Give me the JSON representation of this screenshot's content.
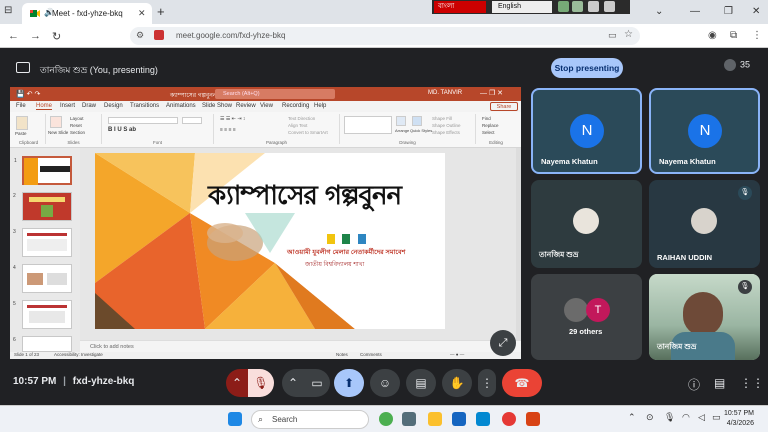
{
  "browser": {
    "tab_title": "Meet - fxd-yhze-bkq",
    "url": "meet.google.com/fxd-yhze-bkq",
    "bangla_bar": {
      "left_text": "বাংলা",
      "english_label": "English"
    }
  },
  "meet": {
    "presenting_text": "তানজিম শুভ্র (You, presenting)",
    "stop_presenting_label": "Stop presenting",
    "participant_count": "35",
    "time": "10:57 PM",
    "meeting_code": "fxd-yhze-bkq",
    "participants": [
      {
        "name": "Nayema Khatun",
        "initial": "N"
      },
      {
        "name": "Nayema Khatun",
        "initial": "N"
      },
      {
        "name": "তানজিম শুভ্র"
      },
      {
        "name": "RAIHAN UDDIN"
      },
      {
        "name": "29 others",
        "initial": "T"
      },
      {
        "name": "তানজিম শুভ্র"
      }
    ]
  },
  "powerpoint": {
    "file_name": "ক্যাম্পাসের গল্পবুনন_Mi.pptx - PowerPoint",
    "search_placeholder": "Search (Alt+Q)",
    "user": "MD. TANVIR",
    "share_label": "Share",
    "tabs": [
      "File",
      "Home",
      "Insert",
      "Draw",
      "Design",
      "Transitions",
      "Animations",
      "Slide Show",
      "Review",
      "View",
      "Recording",
      "Help"
    ],
    "ribbon_groups": [
      "Clipboard",
      "Slides",
      "Font",
      "Paragraph",
      "Drawing",
      "Editing"
    ],
    "ribbon_labels": {
      "paste": "Paste",
      "new_slide": "New Slide",
      "layout": "Layout",
      "reset": "Reset",
      "section": "Section",
      "arrange": "Arrange",
      "quick_styles": "Quick Styles",
      "shape_fill": "Shape Fill",
      "shape_outline": "Shape Outline",
      "shape_effects": "Shape Effects",
      "find": "Find",
      "replace": "Replace",
      "select": "Select",
      "text_direction": "Text Direction",
      "align_text": "Align Text",
      "convert_smartart": "Convert to SmartArt"
    },
    "slide_numbers": [
      "1",
      "2",
      "3",
      "4",
      "5",
      "6"
    ],
    "slide": {
      "title": "ক্যাম্পাসের গল্পবুনন",
      "subtitle": "আওয়ামী যুবলীগ মেলার নেতাকর্মীদের সমাবেশ",
      "sub_subtitle": "জাতীয় বিশ্ববিদ্যালয় শাখা"
    },
    "notes_placeholder": "Click to add notes",
    "status_left": "Slide 1 of 23",
    "status_access": "Accessibility: Investigate",
    "status_notes": "Notes",
    "status_comments": "Comments"
  },
  "taskbar": {
    "search_label": "Search",
    "clock_time": "10:57 PM",
    "clock_date": "4/3/2026"
  },
  "colors": {
    "meet_bg": "#202124",
    "stop_btn": "#a8c7fa",
    "ppt_accent": "#b7472a",
    "end_call": "#ea4335"
  }
}
